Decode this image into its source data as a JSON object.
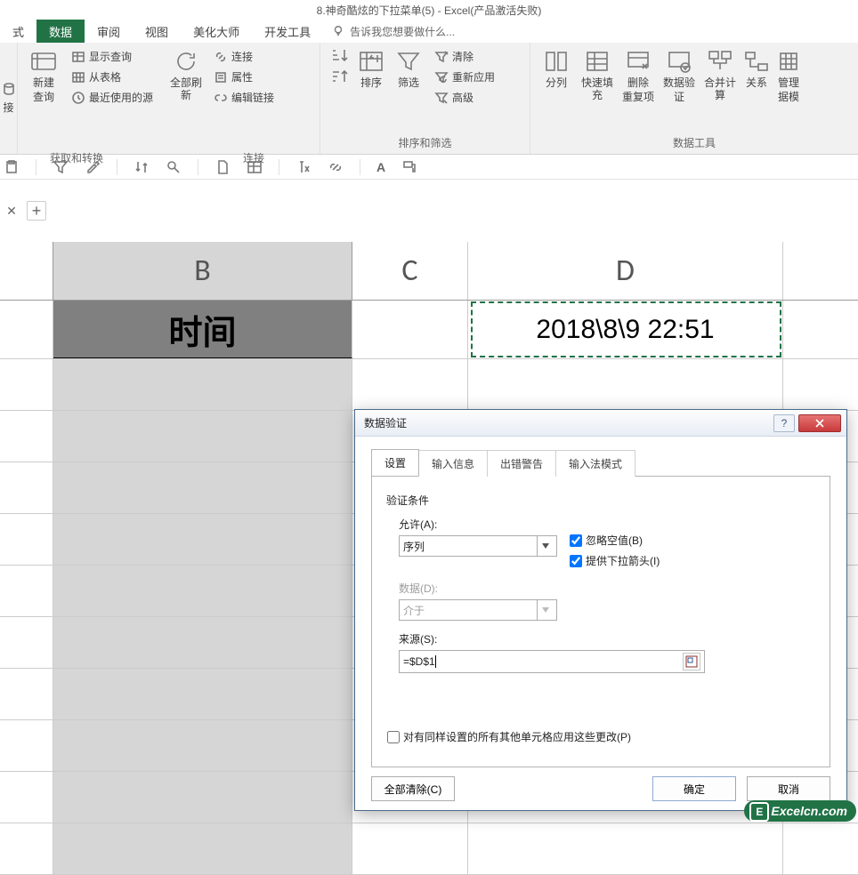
{
  "title": "8.神奇酷炫的下拉菜单(5) - Excel(产品激活失败)",
  "menu": {
    "items": [
      "式",
      "数据",
      "审阅",
      "视图",
      "美化大师",
      "开发工具"
    ],
    "tell": "告诉我您想要做什么..."
  },
  "ribbon": {
    "edge_label": "接",
    "groups": [
      {
        "label": "获取和转换",
        "big": [
          {
            "l1": "新建",
            "l2": "查询"
          },
          {
            "l1": "全部刷新",
            "l2": ""
          }
        ],
        "small": [
          "显示查询",
          "从表格",
          "最近使用的源",
          "连接",
          "属性",
          "编辑链接"
        ]
      },
      {
        "label": "连接"
      },
      {
        "label": "排序和筛选",
        "big": [
          {
            "l1": "排序"
          },
          {
            "l1": "筛选"
          }
        ],
        "small": [
          "清除",
          "重新应用",
          "高级"
        ]
      },
      {
        "label": "数据工具",
        "big": [
          {
            "l1": "分列"
          },
          {
            "l1": "快速填充"
          },
          {
            "l1": "删除",
            "l2": "重复项"
          },
          {
            "l1": "数据验",
            "l2": "证"
          },
          {
            "l1": "合并计算"
          },
          {
            "l1": "关系"
          },
          {
            "l1": "管理",
            "l2": "据模"
          }
        ]
      }
    ]
  },
  "columns": [
    "",
    "B",
    "C",
    "D"
  ],
  "cells": {
    "B1": "时间",
    "D1": "2018\\8\\9 22:51"
  },
  "dialog": {
    "title": "数据验证",
    "tabs": [
      "设置",
      "输入信息",
      "出错警告",
      "输入法模式"
    ],
    "criteria_label": "验证条件",
    "allow_label": "允许(A):",
    "allow_value": "序列",
    "data_label": "数据(D):",
    "data_value": "介于",
    "ignore_blank": "忽略空值(B)",
    "dropdown_arrow": "提供下拉箭头(I)",
    "source_label": "来源(S):",
    "source_value": "=$D$1",
    "apply_all": "对有同样设置的所有其他单元格应用这些更改(P)",
    "clear_all": "全部清除(C)",
    "ok": "确定",
    "cancel": "取消"
  },
  "watermark": "Excelcn.com"
}
